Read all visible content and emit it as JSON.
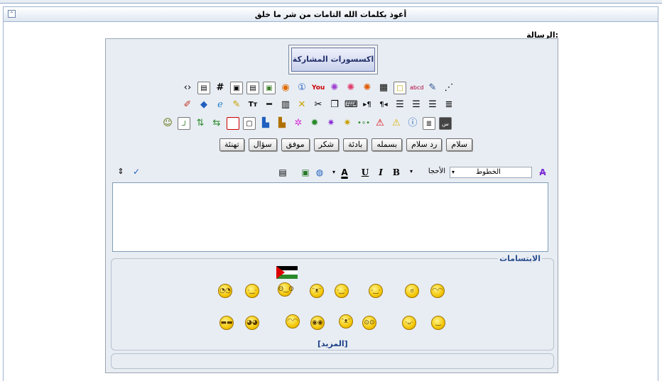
{
  "header": {
    "title": "أعوذ بكلمات الله التامات من شر ما خلق"
  },
  "form": {
    "message_label": "الرسالة:"
  },
  "accessories_button": {
    "label": "اكسسورات المشاركة"
  },
  "icon_row_1": [
    "code-icon",
    "html-icon",
    "hash-icon",
    "image-a-icon",
    "image-b-icon",
    "image-c-icon",
    "media-icon",
    "info-circle-icon",
    "youtube-icon",
    "fireworks-a-icon",
    "fireworks-b-icon",
    "fireworks-c-icon",
    "table-icon",
    "frame-icon",
    "abcd-icon",
    "scroll-icon",
    "sparkle-icon"
  ],
  "icon_row_2": [
    "eraser-icon",
    "book-icon",
    "ie-icon",
    "highlighter-icon",
    "font-size-icon",
    "hr-icon",
    "paste-icon",
    "cross-icon",
    "cut-icon",
    "copy-icon",
    "keyboard-icon",
    "ltr-icon",
    "rtl-icon",
    "align-left-icon",
    "align-center-icon",
    "align-right-icon",
    "justify-icon"
  ],
  "icon_row_3": [
    "user-icon",
    "box-text-icon",
    "arrows-ud-icon",
    "arrows-lr-icon",
    "red-square-icon",
    "frame-square-icon",
    "blue-stamp-icon",
    "stamp-icon",
    "sparkle-a-icon",
    "sparkle-b-icon",
    "star-a-icon",
    "star-b-icon",
    "dots-icon",
    "warning-red-icon",
    "warning-yellow-icon",
    "info-icon",
    "list-box-icon",
    "word-box-icon"
  ],
  "quick_buttons": [
    "سلام",
    "رد سلام",
    "بسمله",
    "بادئة",
    "شكر",
    "موفق",
    "سؤال",
    "تهنئة"
  ],
  "toolbar": {
    "font_label": "الخطوط",
    "size_label": "الأحجا",
    "bold": "B",
    "italic": "I",
    "underline": "U",
    "color_letter": "A"
  },
  "smilies": {
    "legend": "الابتسامات",
    "more": "[المزيد]"
  }
}
